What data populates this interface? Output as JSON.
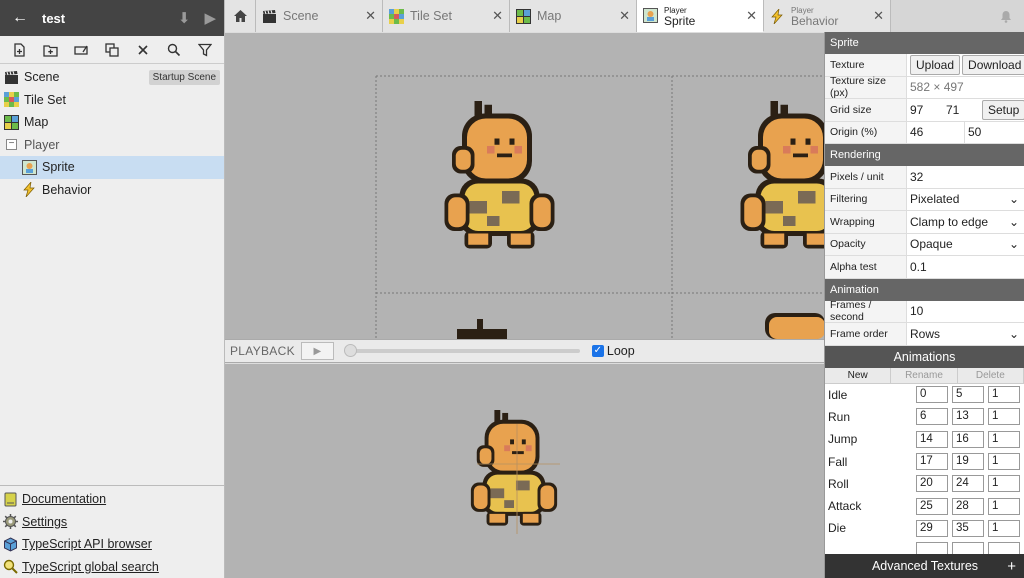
{
  "project": {
    "title": "test"
  },
  "assets": [
    {
      "label": "Scene",
      "icon": "scene-icon",
      "badge": "Startup Scene"
    },
    {
      "label": "Tile Set",
      "icon": "tileset-icon"
    },
    {
      "label": "Map",
      "icon": "map-icon"
    }
  ],
  "folder": {
    "label": "Player",
    "toggle": "−"
  },
  "folder_items": [
    {
      "label": "Sprite",
      "icon": "sprite-icon",
      "selected": true
    },
    {
      "label": "Behavior",
      "icon": "behavior-icon"
    }
  ],
  "help": [
    {
      "label": "Documentation",
      "icon": "book-icon"
    },
    {
      "label": "Settings",
      "icon": "gear-icon"
    },
    {
      "label": "TypeScript API browser",
      "icon": "cube-icon"
    },
    {
      "label": "TypeScript global search",
      "icon": "magnifier-icon"
    }
  ],
  "tabs": [
    {
      "label": "Scene"
    },
    {
      "label": "Tile Set"
    },
    {
      "label": "Map"
    },
    {
      "sub": "Player",
      "label": "Sprite",
      "active": true
    },
    {
      "sub": "Player",
      "label": "Behavior"
    }
  ],
  "playback": {
    "label": "PLAYBACK",
    "loop_label": "Loop",
    "loop_checked": true,
    "position": 0
  },
  "sprite_section": {
    "header": "Sprite",
    "texture_label": "Texture",
    "upload": "Upload",
    "download": "Download",
    "texture_size_label": "Texture size (px)",
    "texture_size": "582 × 497",
    "grid_size_label": "Grid size",
    "grid_w": "97",
    "grid_h": "71",
    "setup": "Setup",
    "origin_label": "Origin (%)",
    "origin_x": "46",
    "origin_y": "50"
  },
  "rendering_section": {
    "header": "Rendering",
    "ppu_label": "Pixels / unit",
    "ppu": "32",
    "filtering_label": "Filtering",
    "filtering": "Pixelated",
    "wrapping_label": "Wrapping",
    "wrapping": "Clamp to edge",
    "opacity_label": "Opacity",
    "opacity": "Opaque",
    "alpha_label": "Alpha test",
    "alpha": "0.1"
  },
  "animation_section": {
    "header": "Animation",
    "fps_label": "Frames / second",
    "fps": "10",
    "order_label": "Frame order",
    "order": "Rows"
  },
  "animations": {
    "header": "Animations",
    "new": "New",
    "rename": "Rename",
    "delete": "Delete",
    "rows": [
      {
        "name": "Idle",
        "start": "0",
        "end": "5",
        "speed": "1"
      },
      {
        "name": "Run",
        "start": "6",
        "end": "13",
        "speed": "1"
      },
      {
        "name": "Jump",
        "start": "14",
        "end": "16",
        "speed": "1"
      },
      {
        "name": "Fall",
        "start": "17",
        "end": "19",
        "speed": "1"
      },
      {
        "name": "Roll",
        "start": "20",
        "end": "24",
        "speed": "1"
      },
      {
        "name": "Attack",
        "start": "25",
        "end": "28",
        "speed": "1"
      },
      {
        "name": "Die",
        "start": "29",
        "end": "35",
        "speed": "1"
      },
      {
        "name": "",
        "start": "",
        "end": "",
        "speed": ""
      }
    ]
  },
  "advanced_textures": {
    "label": "Advanced Textures"
  },
  "colors": {
    "sprite_skin": "#e8a24f",
    "sprite_outline": "#2b2014",
    "accent": "#1a73e8"
  }
}
